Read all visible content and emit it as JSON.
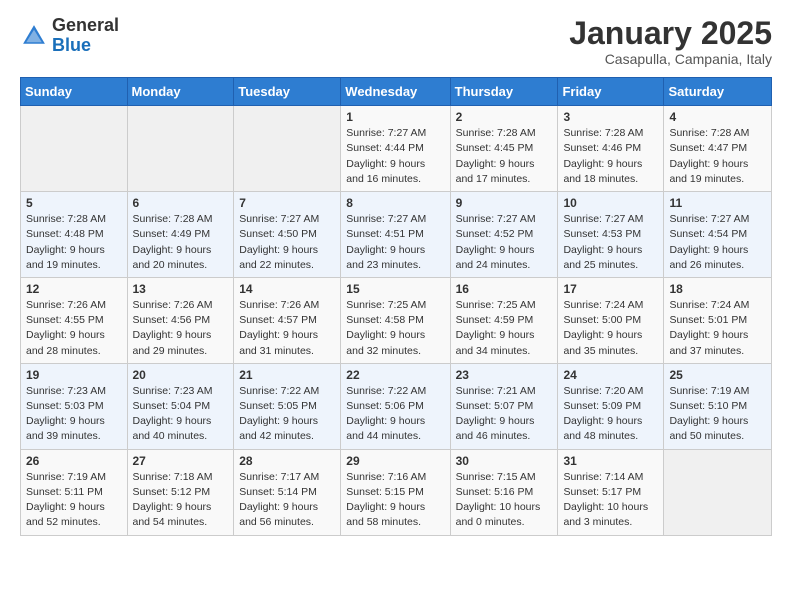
{
  "header": {
    "logo_general": "General",
    "logo_blue": "Blue",
    "month_title": "January 2025",
    "location": "Casapulla, Campania, Italy"
  },
  "days_of_week": [
    "Sunday",
    "Monday",
    "Tuesday",
    "Wednesday",
    "Thursday",
    "Friday",
    "Saturday"
  ],
  "weeks": [
    [
      {
        "day": "",
        "info": ""
      },
      {
        "day": "",
        "info": ""
      },
      {
        "day": "",
        "info": ""
      },
      {
        "day": "1",
        "info": "Sunrise: 7:27 AM\nSunset: 4:44 PM\nDaylight: 9 hours\nand 16 minutes."
      },
      {
        "day": "2",
        "info": "Sunrise: 7:28 AM\nSunset: 4:45 PM\nDaylight: 9 hours\nand 17 minutes."
      },
      {
        "day": "3",
        "info": "Sunrise: 7:28 AM\nSunset: 4:46 PM\nDaylight: 9 hours\nand 18 minutes."
      },
      {
        "day": "4",
        "info": "Sunrise: 7:28 AM\nSunset: 4:47 PM\nDaylight: 9 hours\nand 19 minutes."
      }
    ],
    [
      {
        "day": "5",
        "info": "Sunrise: 7:28 AM\nSunset: 4:48 PM\nDaylight: 9 hours\nand 19 minutes."
      },
      {
        "day": "6",
        "info": "Sunrise: 7:28 AM\nSunset: 4:49 PM\nDaylight: 9 hours\nand 20 minutes."
      },
      {
        "day": "7",
        "info": "Sunrise: 7:27 AM\nSunset: 4:50 PM\nDaylight: 9 hours\nand 22 minutes."
      },
      {
        "day": "8",
        "info": "Sunrise: 7:27 AM\nSunset: 4:51 PM\nDaylight: 9 hours\nand 23 minutes."
      },
      {
        "day": "9",
        "info": "Sunrise: 7:27 AM\nSunset: 4:52 PM\nDaylight: 9 hours\nand 24 minutes."
      },
      {
        "day": "10",
        "info": "Sunrise: 7:27 AM\nSunset: 4:53 PM\nDaylight: 9 hours\nand 25 minutes."
      },
      {
        "day": "11",
        "info": "Sunrise: 7:27 AM\nSunset: 4:54 PM\nDaylight: 9 hours\nand 26 minutes."
      }
    ],
    [
      {
        "day": "12",
        "info": "Sunrise: 7:26 AM\nSunset: 4:55 PM\nDaylight: 9 hours\nand 28 minutes."
      },
      {
        "day": "13",
        "info": "Sunrise: 7:26 AM\nSunset: 4:56 PM\nDaylight: 9 hours\nand 29 minutes."
      },
      {
        "day": "14",
        "info": "Sunrise: 7:26 AM\nSunset: 4:57 PM\nDaylight: 9 hours\nand 31 minutes."
      },
      {
        "day": "15",
        "info": "Sunrise: 7:25 AM\nSunset: 4:58 PM\nDaylight: 9 hours\nand 32 minutes."
      },
      {
        "day": "16",
        "info": "Sunrise: 7:25 AM\nSunset: 4:59 PM\nDaylight: 9 hours\nand 34 minutes."
      },
      {
        "day": "17",
        "info": "Sunrise: 7:24 AM\nSunset: 5:00 PM\nDaylight: 9 hours\nand 35 minutes."
      },
      {
        "day": "18",
        "info": "Sunrise: 7:24 AM\nSunset: 5:01 PM\nDaylight: 9 hours\nand 37 minutes."
      }
    ],
    [
      {
        "day": "19",
        "info": "Sunrise: 7:23 AM\nSunset: 5:03 PM\nDaylight: 9 hours\nand 39 minutes."
      },
      {
        "day": "20",
        "info": "Sunrise: 7:23 AM\nSunset: 5:04 PM\nDaylight: 9 hours\nand 40 minutes."
      },
      {
        "day": "21",
        "info": "Sunrise: 7:22 AM\nSunset: 5:05 PM\nDaylight: 9 hours\nand 42 minutes."
      },
      {
        "day": "22",
        "info": "Sunrise: 7:22 AM\nSunset: 5:06 PM\nDaylight: 9 hours\nand 44 minutes."
      },
      {
        "day": "23",
        "info": "Sunrise: 7:21 AM\nSunset: 5:07 PM\nDaylight: 9 hours\nand 46 minutes."
      },
      {
        "day": "24",
        "info": "Sunrise: 7:20 AM\nSunset: 5:09 PM\nDaylight: 9 hours\nand 48 minutes."
      },
      {
        "day": "25",
        "info": "Sunrise: 7:19 AM\nSunset: 5:10 PM\nDaylight: 9 hours\nand 50 minutes."
      }
    ],
    [
      {
        "day": "26",
        "info": "Sunrise: 7:19 AM\nSunset: 5:11 PM\nDaylight: 9 hours\nand 52 minutes."
      },
      {
        "day": "27",
        "info": "Sunrise: 7:18 AM\nSunset: 5:12 PM\nDaylight: 9 hours\nand 54 minutes."
      },
      {
        "day": "28",
        "info": "Sunrise: 7:17 AM\nSunset: 5:14 PM\nDaylight: 9 hours\nand 56 minutes."
      },
      {
        "day": "29",
        "info": "Sunrise: 7:16 AM\nSunset: 5:15 PM\nDaylight: 9 hours\nand 58 minutes."
      },
      {
        "day": "30",
        "info": "Sunrise: 7:15 AM\nSunset: 5:16 PM\nDaylight: 10 hours\nand 0 minutes."
      },
      {
        "day": "31",
        "info": "Sunrise: 7:14 AM\nSunset: 5:17 PM\nDaylight: 10 hours\nand 3 minutes."
      },
      {
        "day": "",
        "info": ""
      }
    ]
  ]
}
